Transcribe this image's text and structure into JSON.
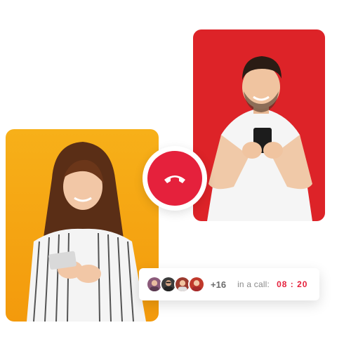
{
  "call": {
    "extra_participants": "+16",
    "status_label": "in a call:",
    "timer": "08 : 20"
  },
  "participants": [
    {
      "name": "avatar-1",
      "color": "#8b5a7a"
    },
    {
      "name": "avatar-2",
      "color": "#3b3b3b"
    },
    {
      "name": "avatar-3",
      "color": "#9b3a2e"
    },
    {
      "name": "avatar-4",
      "color": "#c0392b"
    }
  ],
  "colors": {
    "accent": "#e5213c",
    "man_background": "#e0262a",
    "woman_background": "#f5a413"
  },
  "icons": {
    "hangup": "phone-hangup-icon"
  }
}
